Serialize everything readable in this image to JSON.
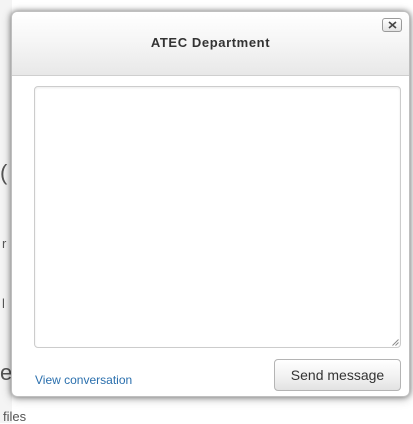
{
  "dialog": {
    "title": "ATEC Department",
    "close_icon": "close-x-icon",
    "message": {
      "value": "",
      "placeholder": ""
    },
    "view_conversation_label": "View conversation",
    "send_button_label": "Send message"
  },
  "background": {
    "fragment_1": "(",
    "fragment_2": "r",
    "fragment_3": "l",
    "fragment_4": "e",
    "fragment_5": "files"
  },
  "colors": {
    "link": "#2a6fad",
    "header_gradient_top": "#ffffff",
    "header_gradient_bottom": "#e8e8e8",
    "border": "#bfbfbf"
  }
}
